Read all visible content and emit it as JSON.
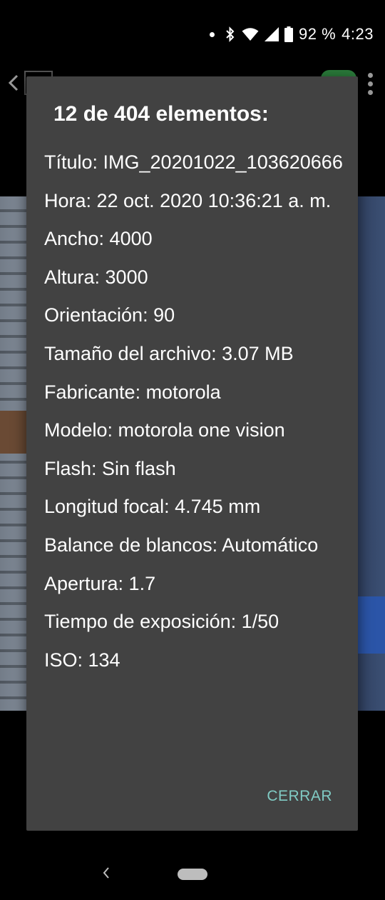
{
  "status_bar": {
    "battery": "92 %",
    "time": "4:23"
  },
  "dialog": {
    "title": "12 de 404 elementos:",
    "details": [
      "Título: IMG_20201022_103620666",
      "Hora: 22 oct. 2020 10:36:21 a. m.",
      "Ancho: 4000",
      "Altura: 3000",
      "Orientación: 90",
      "Tamaño del archivo: 3.07 MB",
      "Fabricante: motorola",
      "Modelo: motorola one vision",
      "Flash: Sin flash",
      "Longitud focal: 4.745 mm",
      "Balance de blancos: Automático",
      "Apertura: 1.7",
      "Tiempo de exposición: 1/50",
      "ISO: 134"
    ],
    "close_label": "CERRAR"
  },
  "colors": {
    "dialog_background": "#424242",
    "accent": "#80cbc4"
  }
}
